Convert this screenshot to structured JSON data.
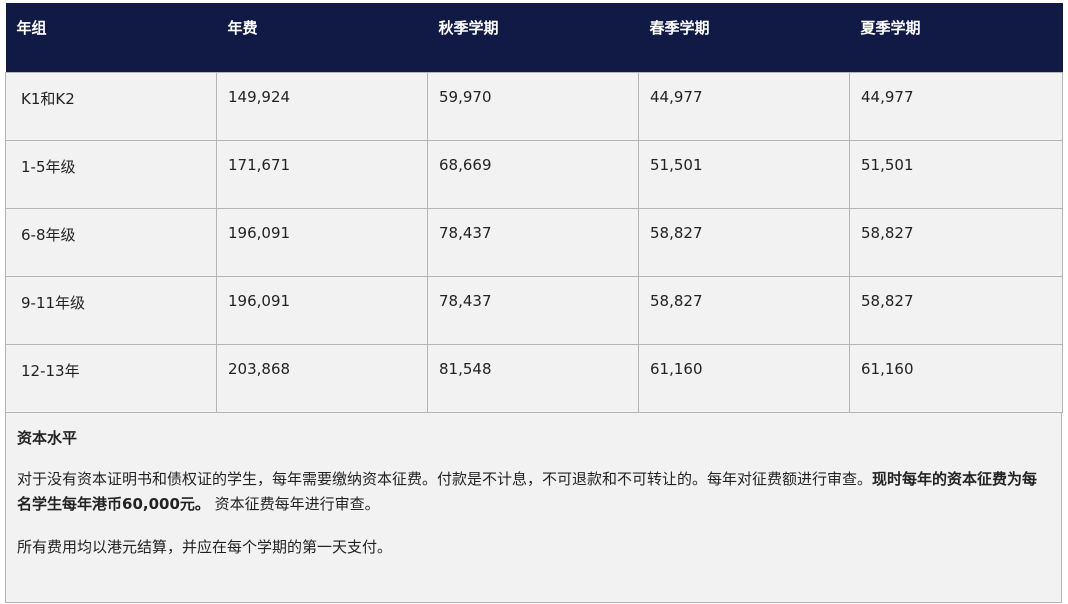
{
  "table": {
    "headers": [
      "年组",
      "年费",
      "秋季学期",
      "春季学期",
      "夏季学期"
    ],
    "rows": [
      [
        "K1和K2",
        "149,924",
        "59,970",
        "44,977",
        "44,977"
      ],
      [
        "1-5年级",
        "171,671",
        "68,669",
        "51,501",
        "51,501"
      ],
      [
        "6-8年级",
        "196,091",
        "78,437",
        "58,827",
        "58,827"
      ],
      [
        "9-11年级",
        "196,091",
        "78,437",
        "58,827",
        "58,827"
      ],
      [
        "12-13年",
        "203,868",
        "81,548",
        "61,160",
        "61,160"
      ]
    ]
  },
  "notes": {
    "heading": "资本水平",
    "para1_text": "对于没有资本证明书和债权证的学生，每年需要缴纳资本征费。付款是不计息，不可退款和不可转让的。每年对征费额进行审查。",
    "para1_bold": "现时每年的资本征费为每名学生每年港币60,000元。",
    "para1_tail": " 资本征费每年进行审查。",
    "para2": "所有费用均以港元结算，并应在每个学期的第一天支付。"
  },
  "colors": {
    "header_bg": "#111a44",
    "cell_bg": "#f2f2f2",
    "border": "#b5b5b5"
  }
}
